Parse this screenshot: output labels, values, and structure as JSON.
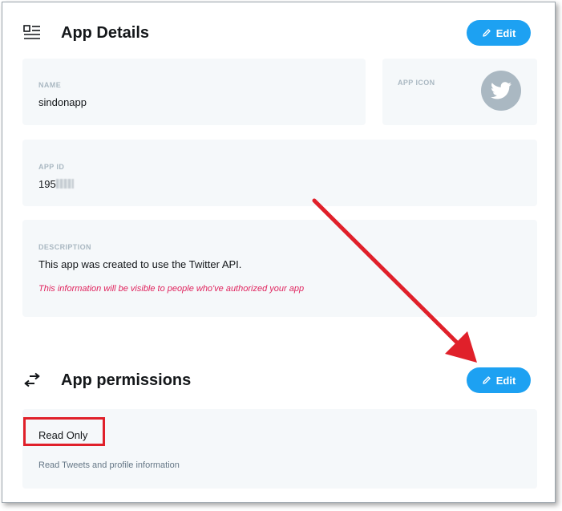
{
  "app_details": {
    "title": "App Details",
    "edit_label": "Edit",
    "name_label": "NAME",
    "name_value": "sindonapp",
    "icon_label": "APP ICON",
    "app_id_label": "APP ID",
    "app_id_value": "195",
    "description_label": "DESCRIPTION",
    "description_value": "This app was created to use the Twitter API.",
    "visibility_note": "This information will be visible to people who've authorized your app"
  },
  "app_permissions": {
    "title": "App permissions",
    "edit_label": "Edit",
    "permission_value": "Read Only",
    "permission_description": "Read Tweets and profile information"
  },
  "colors": {
    "accent": "#1da1f2",
    "card_bg": "#f5f8fa",
    "annotation_red": "#e0202a",
    "note_red": "#e0245e"
  },
  "icons": {
    "app_details": "details-list-icon",
    "permissions": "swap-arrows-icon",
    "edit": "pencil-icon",
    "app_icon": "twitter-bird-icon"
  }
}
